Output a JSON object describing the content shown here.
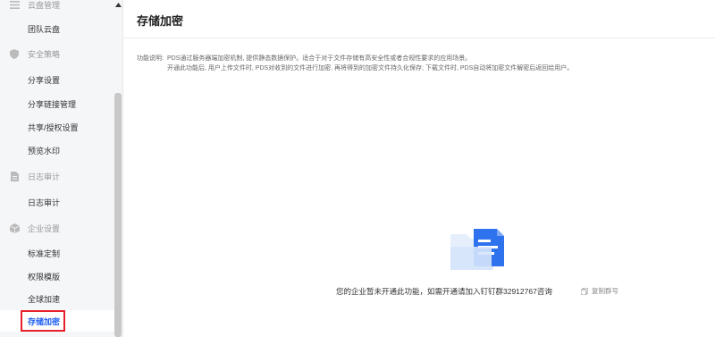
{
  "sidebar": {
    "sections": [
      {
        "label": "云盘管理",
        "icon": "list-icon",
        "items": [
          {
            "label": "团队云盘"
          }
        ]
      },
      {
        "label": "安全策略",
        "icon": "shield-icon",
        "items": [
          {
            "label": "分享设置"
          },
          {
            "label": "分享链接管理"
          },
          {
            "label": "共享/授权设置"
          },
          {
            "label": "预览水印"
          }
        ]
      },
      {
        "label": "日志审计",
        "icon": "document-icon",
        "items": [
          {
            "label": "日志审计"
          }
        ]
      },
      {
        "label": "企业设置",
        "icon": "cube-icon",
        "items": [
          {
            "label": "标准定制"
          },
          {
            "label": "权限模版"
          },
          {
            "label": "全球加速"
          },
          {
            "label": "存储加密"
          }
        ]
      }
    ],
    "active_item": "存储加密"
  },
  "page": {
    "title": "存储加密",
    "description": {
      "label": "功能说明:",
      "line1": "PDS通过服务器端加密机制, 提供静态数据保护。适合于对于文件存储有高安全性或者合规性要求的应用场景。",
      "line2": "开通此功能后, 用户上传文件时, PDS对收到的文件进行加密, 再将得到的加密文件持久化保存; 下载文件时, PDS自动将加密文件解密后返回给用户。"
    },
    "empty_state": {
      "icon": "folder-document-icon",
      "message": "您的企业暂未开通此功能，如需开通请加入钉钉群32912767咨询",
      "copy_label": "复制群号",
      "copy_icon": "copy-icon"
    }
  },
  "colors": {
    "accent": "#1f5ff0",
    "highlight_border": "#e8202a",
    "sidebar_bg": "#f5f6f8"
  }
}
